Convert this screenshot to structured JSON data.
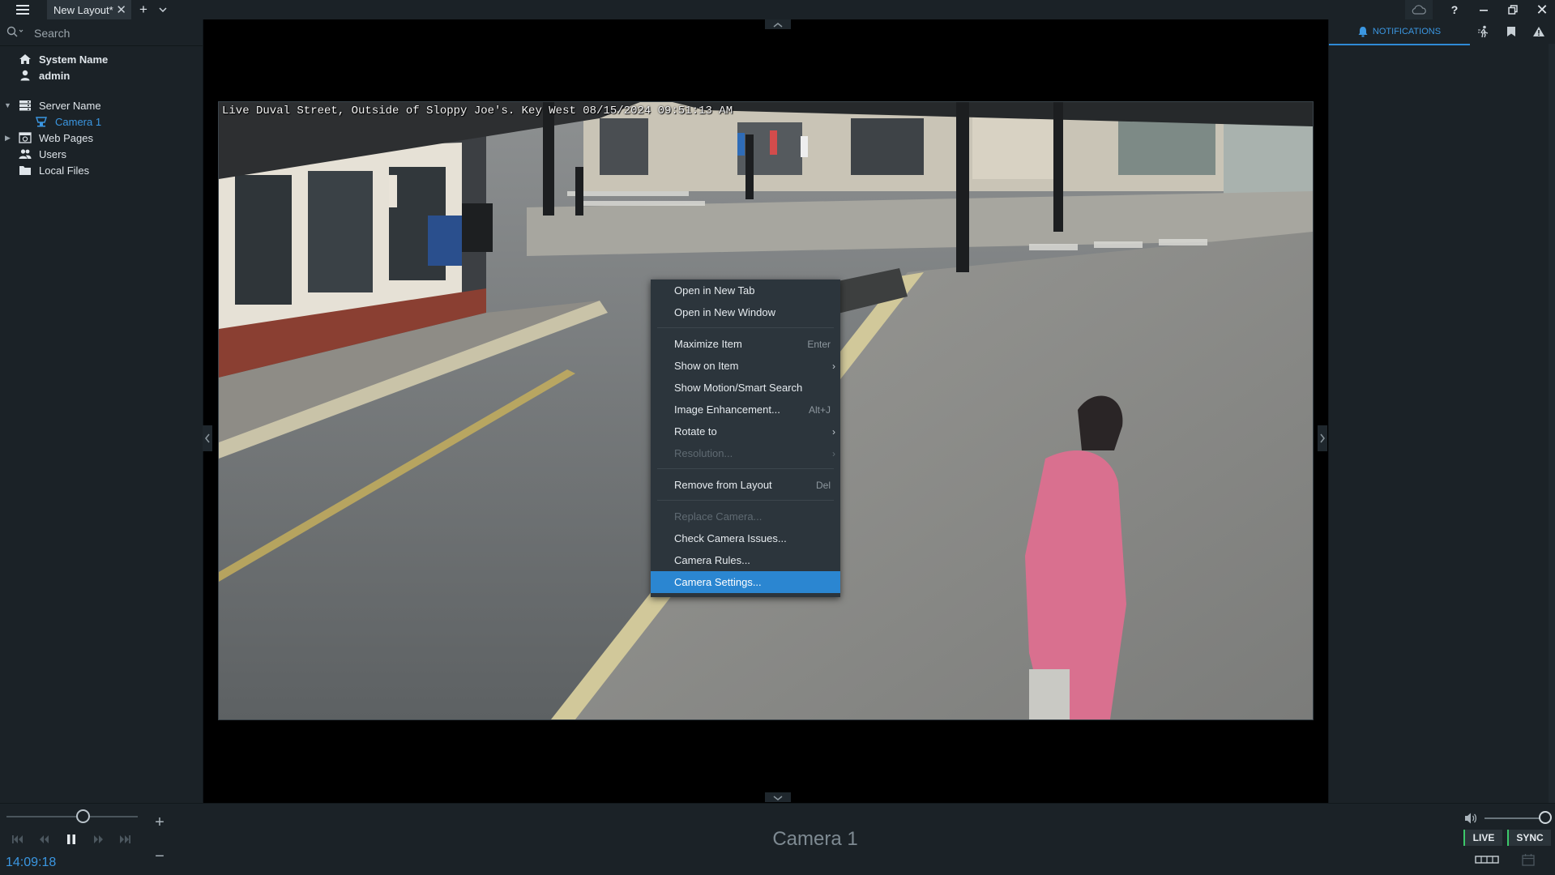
{
  "titlebar": {
    "tab_title": "New Layout*",
    "tab_close": "✕",
    "add_tab": "+",
    "help": "?",
    "close": "✕"
  },
  "left_panel": {
    "search_placeholder": "Search",
    "tree": {
      "system_name": "System Name",
      "user": "admin",
      "server": "Server Name",
      "camera": "Camera 1",
      "web_pages": "Web Pages",
      "users": "Users",
      "local_files": "Local Files"
    }
  },
  "camera_view": {
    "osd_text": "Live Duval Street, Outside of Sloppy Joe's.  Key West 08/15/2024 09:51:13 AM"
  },
  "context_menu": {
    "items": [
      {
        "label": "Open in New Tab",
        "shortcut": "",
        "submenu": false,
        "disabled": false
      },
      {
        "label": "Open in New Window",
        "shortcut": "",
        "submenu": false,
        "disabled": false
      },
      {
        "label": "Maximize Item",
        "shortcut": "Enter",
        "submenu": false,
        "disabled": false
      },
      {
        "label": "Show on Item",
        "shortcut": "",
        "submenu": true,
        "disabled": false
      },
      {
        "label": "Show Motion/Smart Search",
        "shortcut": "",
        "submenu": false,
        "disabled": false
      },
      {
        "label": "Image Enhancement...",
        "shortcut": "Alt+J",
        "submenu": false,
        "disabled": false
      },
      {
        "label": "Rotate to",
        "shortcut": "",
        "submenu": true,
        "disabled": false
      },
      {
        "label": "Resolution...",
        "shortcut": "",
        "submenu": true,
        "disabled": true
      },
      {
        "label": "Remove from Layout",
        "shortcut": "Del",
        "submenu": false,
        "disabled": false
      },
      {
        "label": "Replace Camera...",
        "shortcut": "",
        "submenu": false,
        "disabled": true
      },
      {
        "label": "Check Camera Issues...",
        "shortcut": "",
        "submenu": false,
        "disabled": false
      },
      {
        "label": "Camera Rules...",
        "shortcut": "",
        "submenu": false,
        "disabled": false
      },
      {
        "label": "Camera Settings...",
        "shortcut": "",
        "submenu": false,
        "disabled": false,
        "highlighted": true
      }
    ],
    "submenu_glyph": "›"
  },
  "right_panel": {
    "notifications_tab": "NOTIFICATIONS"
  },
  "bottom_bar": {
    "timecode": "14:09:18",
    "camera_name": "Camera 1",
    "live_label": "LIVE",
    "sync_label": "SYNC",
    "zoom_in": "+",
    "zoom_out": "−"
  },
  "colors": {
    "accent": "#2b86d1",
    "link_blue": "#3b97e2",
    "panel_bg": "#1b2227",
    "menu_bg": "#2c353c",
    "live_indicator": "#3cc86a"
  }
}
